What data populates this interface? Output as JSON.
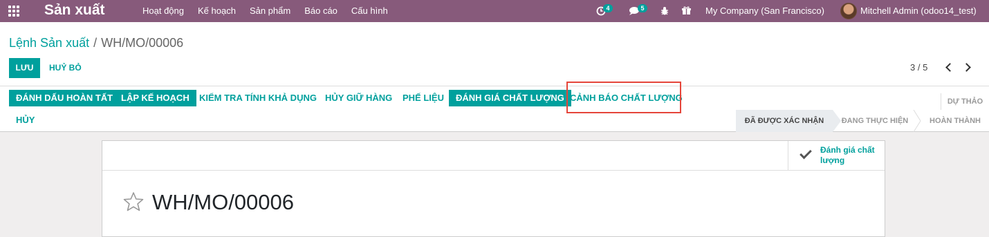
{
  "navbar": {
    "brand": "Sản xuất",
    "menu": [
      "Hoạt động",
      "Kế hoạch",
      "Sản phẩm",
      "Báo cáo",
      "Cấu hình"
    ],
    "activity_count": "4",
    "message_count": "5",
    "company": "My Company (San Francisco)",
    "user": "Mitchell Admin (odoo14_test)"
  },
  "breadcrumb": {
    "parent": "Lệnh Sản xuất",
    "separator": "/",
    "current": "WH/MO/00006"
  },
  "form_buttons": {
    "save": "LƯU",
    "discard": "HUỶ BỎ"
  },
  "pager": {
    "value": "3 / 5"
  },
  "header_buttons": {
    "mark_done": "ĐÁNH DẤU HOÀN TẤT",
    "plan": "LẬP KẾ HOẠCH",
    "check_availability": "KIỂM TRA TÍNH KHẢ DỤNG",
    "unreserve": "HỦY GIỮ HÀNG",
    "scrap": "PHẾ LIỆU",
    "quality_check": "ĐÁNH GIÁ CHẤT LƯỢNG",
    "quality_alert": "CẢNH BÁO CHẤT LƯỢNG",
    "cancel": "HỦY"
  },
  "status": {
    "draft": "DỰ THẢO",
    "steps": [
      "ĐÃ ĐƯỢC XÁC NHẬN",
      "ĐANG THỰC HIỆN",
      "HOÀN THÀNH"
    ],
    "active_step": "ĐÃ ĐƯỢC XÁC NHẬN"
  },
  "sheet": {
    "stat_button_line1": "Đánh giá chất",
    "stat_button_line2": "lượng",
    "record_name": "WH/MO/00006"
  },
  "colors": {
    "navbar": "#875a7b",
    "primary": "#00a09d",
    "highlight": "#e5453a"
  }
}
